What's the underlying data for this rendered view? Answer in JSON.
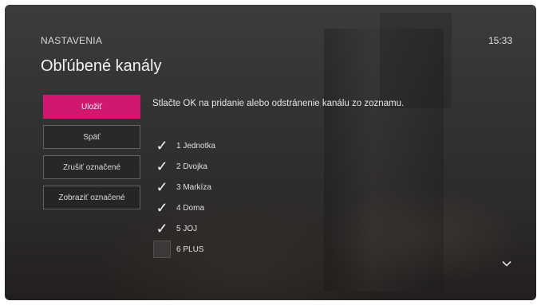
{
  "header": {
    "section": "NASTAVENIA",
    "title": "Obľúbené kanály",
    "clock": "15:33"
  },
  "instruction": "Stlačte OK na pridanie alebo odstránenie kanálu zo zoznamu.",
  "menu": [
    {
      "label": "Uložiť",
      "active": true
    },
    {
      "label": "Späť",
      "active": false
    },
    {
      "label": "Zrušiť označené",
      "active": false
    },
    {
      "label": "Zobraziť označené",
      "active": false
    }
  ],
  "channels": [
    {
      "label": "1 Jednotka",
      "checked": true
    },
    {
      "label": "2 Dvojka",
      "checked": true
    },
    {
      "label": "3 Markíza",
      "checked": true
    },
    {
      "label": "4 Doma",
      "checked": true
    },
    {
      "label": "5 JOJ",
      "checked": true
    },
    {
      "label": "6 PLUS",
      "checked": false
    }
  ],
  "icons": {
    "checkmark": "check-icon",
    "scroll": "chevron-down-icon"
  },
  "colors": {
    "accent": "#d1176e"
  }
}
